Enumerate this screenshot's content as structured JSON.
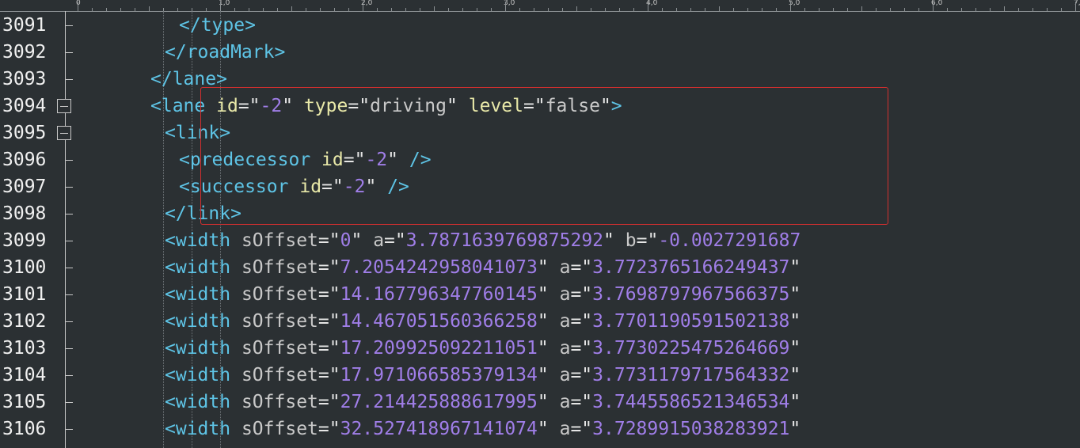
{
  "ruler": {
    "labels": [
      "0",
      "1,0",
      "2,0",
      "3,0",
      "4,0",
      "5,0",
      "6,0",
      "7,0"
    ]
  },
  "lines": [
    {
      "num": "3091",
      "indent": 7,
      "parts": [
        [
          "tag",
          "</type>"
        ]
      ]
    },
    {
      "num": "3092",
      "indent": 6,
      "parts": [
        [
          "tag",
          "</roadMark>"
        ]
      ]
    },
    {
      "num": "3093",
      "indent": 5,
      "parts": [
        [
          "tag",
          "</lane>"
        ]
      ]
    },
    {
      "num": "3094",
      "indent": 5,
      "fold": true,
      "parts": [
        [
          "tag",
          "<lane"
        ],
        [
          "sp",
          " "
        ],
        [
          "attr",
          "id"
        ],
        [
          "eq",
          "="
        ],
        [
          "q",
          "\""
        ],
        [
          "num",
          "-2"
        ],
        [
          "q",
          "\""
        ],
        [
          "sp",
          " "
        ],
        [
          "attr",
          "type"
        ],
        [
          "eq",
          "="
        ],
        [
          "q",
          "\""
        ],
        [
          "str",
          "driving"
        ],
        [
          "q",
          "\""
        ],
        [
          "sp",
          " "
        ],
        [
          "attr",
          "level"
        ],
        [
          "eq",
          "="
        ],
        [
          "q",
          "\""
        ],
        [
          "str",
          "false"
        ],
        [
          "q",
          "\""
        ],
        [
          "tag",
          ">"
        ]
      ]
    },
    {
      "num": "3095",
      "indent": 6,
      "fold": true,
      "parts": [
        [
          "tag",
          "<link>"
        ]
      ]
    },
    {
      "num": "3096",
      "indent": 7,
      "parts": [
        [
          "tag",
          "<predecessor"
        ],
        [
          "sp",
          " "
        ],
        [
          "attr",
          "id"
        ],
        [
          "eq",
          "="
        ],
        [
          "q",
          "\""
        ],
        [
          "num",
          "-2"
        ],
        [
          "q",
          "\""
        ],
        [
          "sp",
          " "
        ],
        [
          "tag",
          "/>"
        ]
      ]
    },
    {
      "num": "3097",
      "indent": 7,
      "parts": [
        [
          "tag",
          "<successor"
        ],
        [
          "sp",
          " "
        ],
        [
          "attr",
          "id"
        ],
        [
          "eq",
          "="
        ],
        [
          "q",
          "\""
        ],
        [
          "num",
          "-2"
        ],
        [
          "q",
          "\""
        ],
        [
          "sp",
          " "
        ],
        [
          "tag",
          "/>"
        ]
      ]
    },
    {
      "num": "3098",
      "indent": 6,
      "parts": [
        [
          "tag",
          "</link>"
        ]
      ]
    },
    {
      "num": "3099",
      "indent": 6,
      "parts": [
        [
          "tag",
          "<width"
        ],
        [
          "sp",
          " "
        ],
        [
          "str",
          "sOffset"
        ],
        [
          "eq",
          "="
        ],
        [
          "q",
          "\""
        ],
        [
          "num",
          "0"
        ],
        [
          "q",
          "\""
        ],
        [
          "sp",
          " "
        ],
        [
          "str",
          "a"
        ],
        [
          "eq",
          "="
        ],
        [
          "q",
          "\""
        ],
        [
          "num",
          "3.7871639769875292"
        ],
        [
          "q",
          "\""
        ],
        [
          "sp",
          " "
        ],
        [
          "str",
          "b"
        ],
        [
          "eq",
          "="
        ],
        [
          "q",
          "\""
        ],
        [
          "num",
          "-0.0027291687"
        ]
      ]
    },
    {
      "num": "3100",
      "indent": 6,
      "parts": [
        [
          "tag",
          "<width"
        ],
        [
          "sp",
          " "
        ],
        [
          "str",
          "sOffset"
        ],
        [
          "eq",
          "="
        ],
        [
          "q",
          "\""
        ],
        [
          "num",
          "7.2054242958041073"
        ],
        [
          "q",
          "\""
        ],
        [
          "sp",
          " "
        ],
        [
          "str",
          "a"
        ],
        [
          "eq",
          "="
        ],
        [
          "q",
          "\""
        ],
        [
          "num",
          "3.7723765166249437"
        ],
        [
          "q",
          "\""
        ]
      ]
    },
    {
      "num": "3101",
      "indent": 6,
      "parts": [
        [
          "tag",
          "<width"
        ],
        [
          "sp",
          " "
        ],
        [
          "str",
          "sOffset"
        ],
        [
          "eq",
          "="
        ],
        [
          "q",
          "\""
        ],
        [
          "num",
          "14.167796347760145"
        ],
        [
          "q",
          "\""
        ],
        [
          "sp",
          " "
        ],
        [
          "str",
          "a"
        ],
        [
          "eq",
          "="
        ],
        [
          "q",
          "\""
        ],
        [
          "num",
          "3.7698797967566375"
        ],
        [
          "q",
          "\""
        ]
      ]
    },
    {
      "num": "3102",
      "indent": 6,
      "parts": [
        [
          "tag",
          "<width"
        ],
        [
          "sp",
          " "
        ],
        [
          "str",
          "sOffset"
        ],
        [
          "eq",
          "="
        ],
        [
          "q",
          "\""
        ],
        [
          "num",
          "14.467051560366258"
        ],
        [
          "q",
          "\""
        ],
        [
          "sp",
          " "
        ],
        [
          "str",
          "a"
        ],
        [
          "eq",
          "="
        ],
        [
          "q",
          "\""
        ],
        [
          "num",
          "3.7701190591502138"
        ],
        [
          "q",
          "\""
        ]
      ]
    },
    {
      "num": "3103",
      "indent": 6,
      "parts": [
        [
          "tag",
          "<width"
        ],
        [
          "sp",
          " "
        ],
        [
          "str",
          "sOffset"
        ],
        [
          "eq",
          "="
        ],
        [
          "q",
          "\""
        ],
        [
          "num",
          "17.209925092211051"
        ],
        [
          "q",
          "\""
        ],
        [
          "sp",
          " "
        ],
        [
          "str",
          "a"
        ],
        [
          "eq",
          "="
        ],
        [
          "q",
          "\""
        ],
        [
          "num",
          "3.7730225475264669"
        ],
        [
          "q",
          "\""
        ]
      ]
    },
    {
      "num": "3104",
      "indent": 6,
      "parts": [
        [
          "tag",
          "<width"
        ],
        [
          "sp",
          " "
        ],
        [
          "str",
          "sOffset"
        ],
        [
          "eq",
          "="
        ],
        [
          "q",
          "\""
        ],
        [
          "num",
          "17.971066585379134"
        ],
        [
          "q",
          "\""
        ],
        [
          "sp",
          " "
        ],
        [
          "str",
          "a"
        ],
        [
          "eq",
          "="
        ],
        [
          "q",
          "\""
        ],
        [
          "num",
          "3.7731179717564332"
        ],
        [
          "q",
          "\""
        ]
      ]
    },
    {
      "num": "3105",
      "indent": 6,
      "parts": [
        [
          "tag",
          "<width"
        ],
        [
          "sp",
          " "
        ],
        [
          "str",
          "sOffset"
        ],
        [
          "eq",
          "="
        ],
        [
          "q",
          "\""
        ],
        [
          "num",
          "27.214425888617995"
        ],
        [
          "q",
          "\""
        ],
        [
          "sp",
          " "
        ],
        [
          "str",
          "a"
        ],
        [
          "eq",
          "="
        ],
        [
          "q",
          "\""
        ],
        [
          "num",
          "3.7445586521346534"
        ],
        [
          "q",
          "\""
        ]
      ]
    },
    {
      "num": "3106",
      "indent": 6,
      "parts": [
        [
          "tag",
          "<width"
        ],
        [
          "sp",
          " "
        ],
        [
          "str",
          "sOffset"
        ],
        [
          "eq",
          "="
        ],
        [
          "q",
          "\""
        ],
        [
          "num",
          "32.527418967141074"
        ],
        [
          "q",
          "\""
        ],
        [
          "sp",
          " "
        ],
        [
          "str",
          "a"
        ],
        [
          "eq",
          "="
        ],
        [
          "q",
          "\""
        ],
        [
          "num",
          "3.7289915038283921"
        ],
        [
          "q",
          "\""
        ]
      ]
    }
  ],
  "colors": {
    "background": "#2b3033",
    "tag": "#5ec4e6",
    "attribute": "#e8e8a8",
    "number": "#a07ee8",
    "highlight_border": "#d32f2f"
  }
}
